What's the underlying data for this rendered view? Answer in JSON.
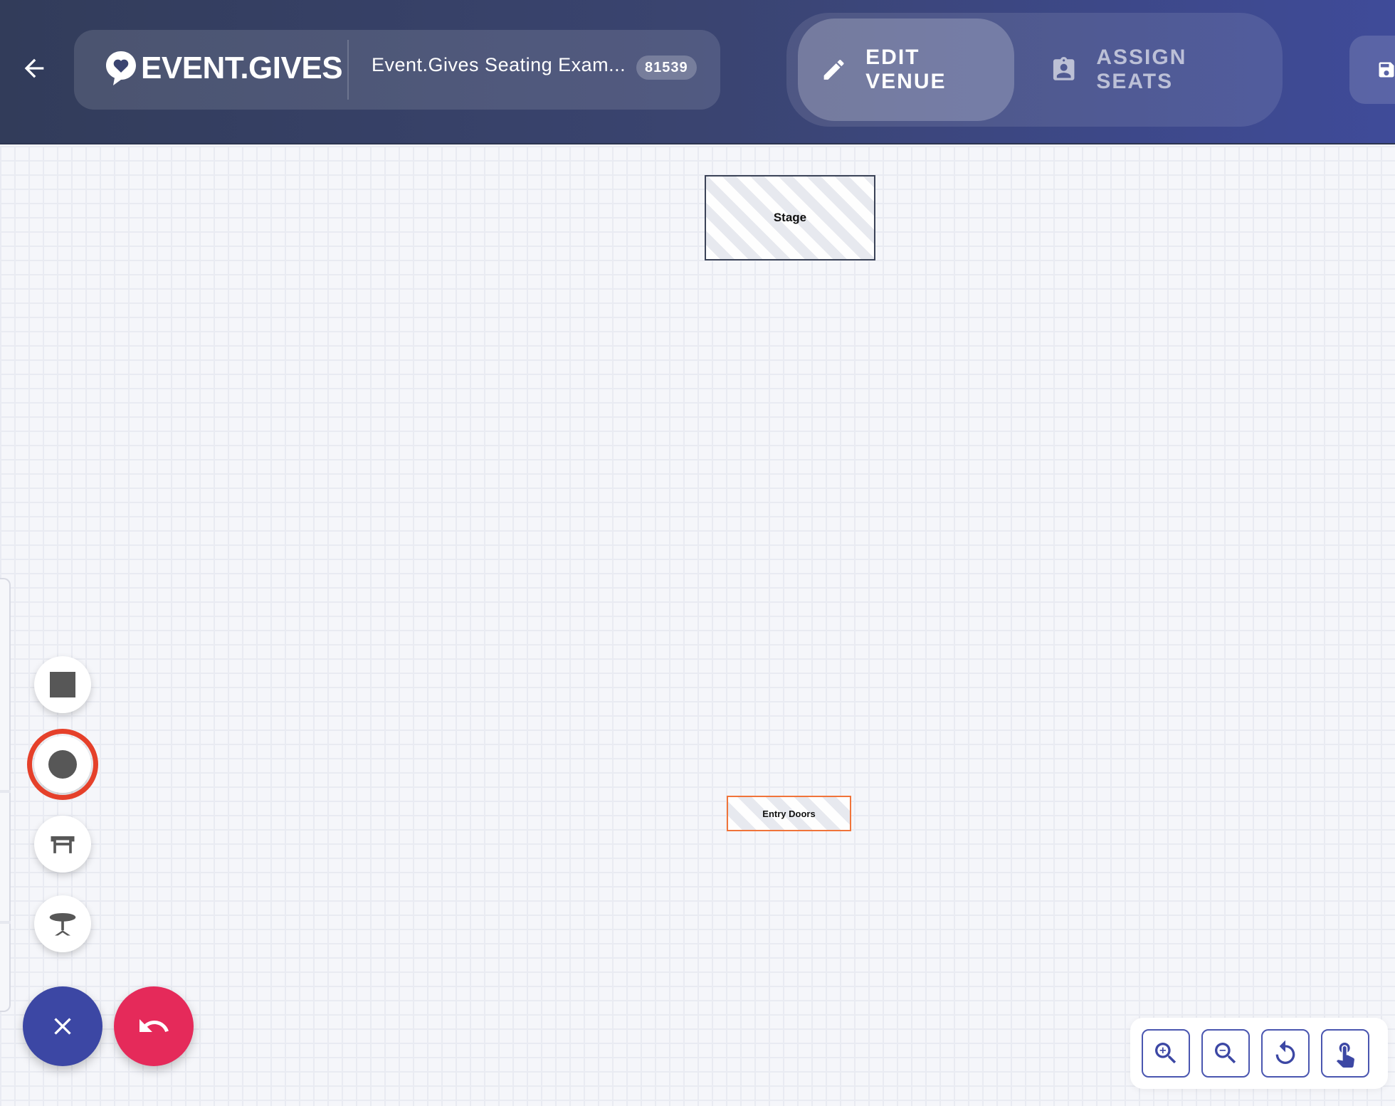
{
  "header": {
    "brand": "EVENT.GIVES",
    "event_name": "Event.Gives Seating Exam...",
    "event_id": "81539",
    "modes": {
      "edit_label": "EDIT VENUE",
      "assign_label": "ASSIGN SEATS",
      "active": "edit"
    }
  },
  "canvas": {
    "objects": {
      "stage_label": "Stage",
      "doors_label": "Entry Doors"
    }
  },
  "tools": {
    "items": [
      "square-shape",
      "circle-shape",
      "rectangular-table",
      "round-table"
    ],
    "selected": "circle-shape"
  },
  "colors": {
    "header_start": "#323c5a",
    "header_end": "#3f4b99",
    "close_fab": "#3c47a4",
    "undo_fab": "#e52a5a",
    "selected_ring": "#e5402a",
    "doors_border": "#f0743a",
    "zoom_accent": "#4a56b0"
  },
  "icons": {
    "back": "arrow-left-icon",
    "edit": "pencil-icon",
    "assign": "badge-icon",
    "save": "save-icon",
    "close": "close-icon",
    "undo": "undo-icon",
    "zoom_in": "zoom-in-icon",
    "zoom_out": "zoom-out-icon",
    "reset": "rotate-icon",
    "pan": "hand-pointer-icon"
  }
}
